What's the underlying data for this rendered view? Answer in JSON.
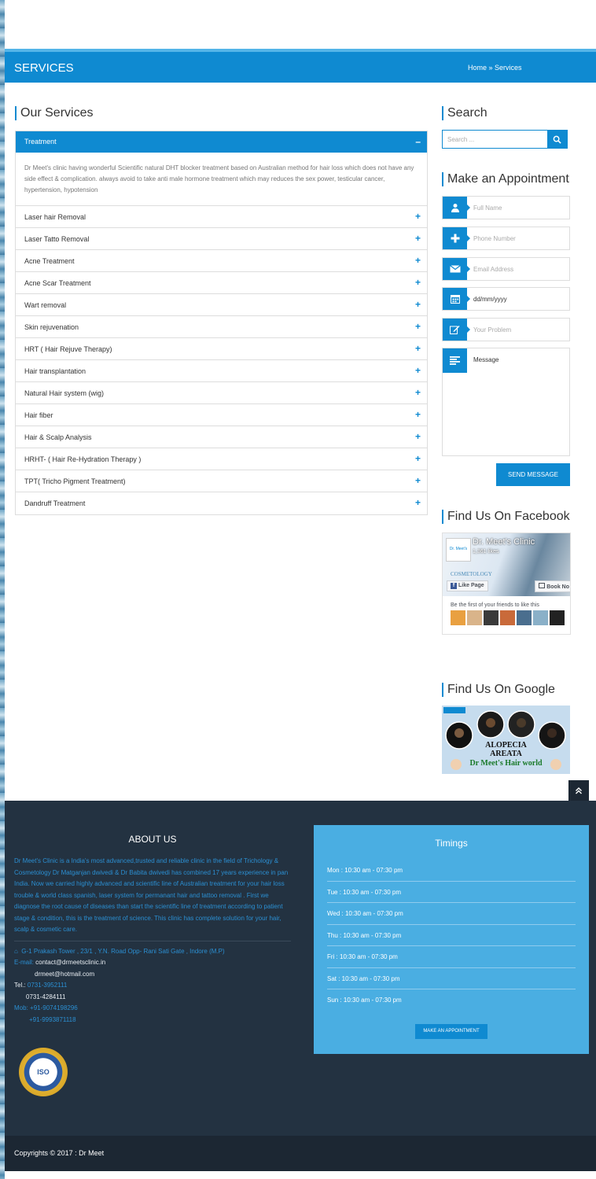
{
  "header": {
    "title": "SERVICES",
    "breadcrumb": "Home » Services"
  },
  "services": {
    "heading": "Our Services",
    "active": {
      "label": "Treatment",
      "toggle": "–",
      "description": "Dr Meet's clinic having wonderful Scientific natural DHT blocker treatment based on Australian method for hair loss which does not have any side effect & complication. always avoid to take anti male hormone treatment which may reduces the sex power, testicular cancer, hypertension, hypotension"
    },
    "items": [
      {
        "label": "Laser hair Removal",
        "toggle": "+"
      },
      {
        "label": "Laser Tatto Removal",
        "toggle": "+"
      },
      {
        "label": "Acne Treatment",
        "toggle": "+"
      },
      {
        "label": "Acne Scar Treatment",
        "toggle": "+"
      },
      {
        "label": "Wart removal",
        "toggle": "+"
      },
      {
        "label": "Skin rejuvenation",
        "toggle": "+"
      },
      {
        "label": "HRT ( Hair Rejuve Therapy)",
        "toggle": "+"
      },
      {
        "label": "Hair transplantation",
        "toggle": "+"
      },
      {
        "label": "Natural Hair system (wig)",
        "toggle": "+"
      },
      {
        "label": "Hair fiber",
        "toggle": "+"
      },
      {
        "label": "Hair & Scalp Analysis",
        "toggle": "+"
      },
      {
        "label": "HRHT- ( Hair Re-Hydration Therapy )",
        "toggle": "+"
      },
      {
        "label": "TPT( Tricho Pigment Treatment)",
        "toggle": "+"
      },
      {
        "label": "Dandruff Treatment",
        "toggle": "+"
      }
    ]
  },
  "sidebar": {
    "search_heading": "Search",
    "search_placeholder": "Search ...",
    "appointment_heading": "Make an Appointment",
    "fields": {
      "full_name": "Full Name",
      "phone": "Phone Number",
      "email": "Email Address",
      "date": "dd/mm/yyyy",
      "problem": "Your Problem",
      "message": "Message"
    },
    "send_label": "SEND MESSAGE",
    "facebook_heading": "Find Us On Facebook",
    "facebook": {
      "page_name": "Dr. Meet's Clinic",
      "likes": "1,361 likes",
      "cover_text": "COSMETOLOGY",
      "like_button": "Like Page",
      "book_button": "Book No",
      "friends_text": "Be the first of your friends to like this"
    },
    "google_heading": "Find Us On Google",
    "google_banner": {
      "line1": "ALOPECIA",
      "line2": "AREATA",
      "brand": "Dr Meet's Hair world"
    }
  },
  "footer": {
    "about_heading": "ABOUT US",
    "about_text": "Dr Meet's Clinic is a India's most advanced,trusted and reliable clinic in the field of Trichology & Cosmetology Dr Matganjan dwivedi & Dr Babita dwivedi has combined 17 years experience in pan India. Now we carried highly advanced and scientific line of Australian treatment for your hair loss trouble & world class spanish, laser system for permanant hair and tattoo removal . First we diagnose the root cause of diseases than start the scientific line of treatment according to patient stage & condition, this is the treatment of science. This clinic has complete solution for your hair, scalp & cosmetic care.",
    "address": "G-1 Prakash Tower , 23/1 , Y.N. Road Opp- Rani Sati Gate , Indore (M.P)",
    "email_label": "E-mail:",
    "email1": "contact@drmeetsclinic.in",
    "email2": "drmeet@hotmail.com",
    "tel_label": "Tel.:",
    "tel1": "0731-3952111",
    "tel2": "0731-4284111",
    "mob_label": "Mob:",
    "mob1": "+91-9074198296",
    "mob2": "+91-9993871118",
    "iso_text": "ISO",
    "timings_heading": "Timings",
    "timings": [
      "Mon : 10:30 am - 07:30 pm",
      "Tue : 10:30 am - 07:30 pm",
      "Wed : 10:30 am - 07:30 pm",
      "Thu : 10:30 am - 07:30 pm",
      "Fri : 10:30 am - 07:30 pm",
      "Sat : 10:30 am - 07:30 pm",
      "Sun : 10:30 am - 07:30 pm"
    ],
    "appointment_button": "MAKE AN APPOINTMENT",
    "copyright": "Copyrights © 2017 : Dr Meet"
  },
  "colors": {
    "accent": "#0f8ad1",
    "timings_bg": "#4aaee2",
    "footer_bg": "#233241",
    "copyright_bg": "#1c2733"
  }
}
